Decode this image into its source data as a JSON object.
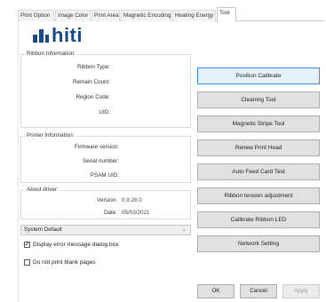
{
  "tabs": [
    {
      "label": "Print Option"
    },
    {
      "label": "Image Color"
    },
    {
      "label": "Print Area"
    },
    {
      "label": "Magnetic Encoding"
    },
    {
      "label": "Heating Energy"
    },
    {
      "label": "Tool",
      "active": true
    }
  ],
  "logo": {
    "text": "hiti",
    "color": "#184a84"
  },
  "ribbon": {
    "title": "Ribbon Information:",
    "rows": [
      {
        "label": "Ribbon Type:",
        "value": ""
      },
      {
        "label": "Remain Count:",
        "value": ""
      },
      {
        "label": "Region Code:",
        "value": ""
      },
      {
        "label": "UID:",
        "value": ""
      }
    ]
  },
  "printer": {
    "title": "Printer Information:",
    "rows": [
      {
        "label": "Firmware version:",
        "value": ""
      },
      {
        "label": "Serial number:",
        "value": ""
      },
      {
        "label": "PSAM UID:",
        "value": ""
      }
    ]
  },
  "driver": {
    "title": "About driver:",
    "version_label": "Version:",
    "version_value": "0.9.28.0",
    "date_label": "Date:",
    "date_value": "05/03/2021"
  },
  "tools": [
    {
      "label": "Position Calibrate"
    },
    {
      "label": "Cleaning Tool"
    },
    {
      "label": "Magnetic Stripe Tool"
    },
    {
      "label": "Renew Print Head"
    },
    {
      "label": "Auto Feed Card Test"
    },
    {
      "label": "Ribbon tension adjustment"
    },
    {
      "label": "Calibrate Ribbon LED"
    },
    {
      "label": "Network Setting"
    }
  ],
  "system_select": {
    "value": "System Default"
  },
  "checkboxes": [
    {
      "label": "Display error message dialog box",
      "checked": true
    },
    {
      "label": "Do not print blank pages",
      "checked": false
    }
  ],
  "footer": {
    "ok": "OK",
    "cancel": "Cancel",
    "apply": "Apply"
  },
  "colors": {
    "accent": "#3a8fd8",
    "brand": "#184a84"
  }
}
